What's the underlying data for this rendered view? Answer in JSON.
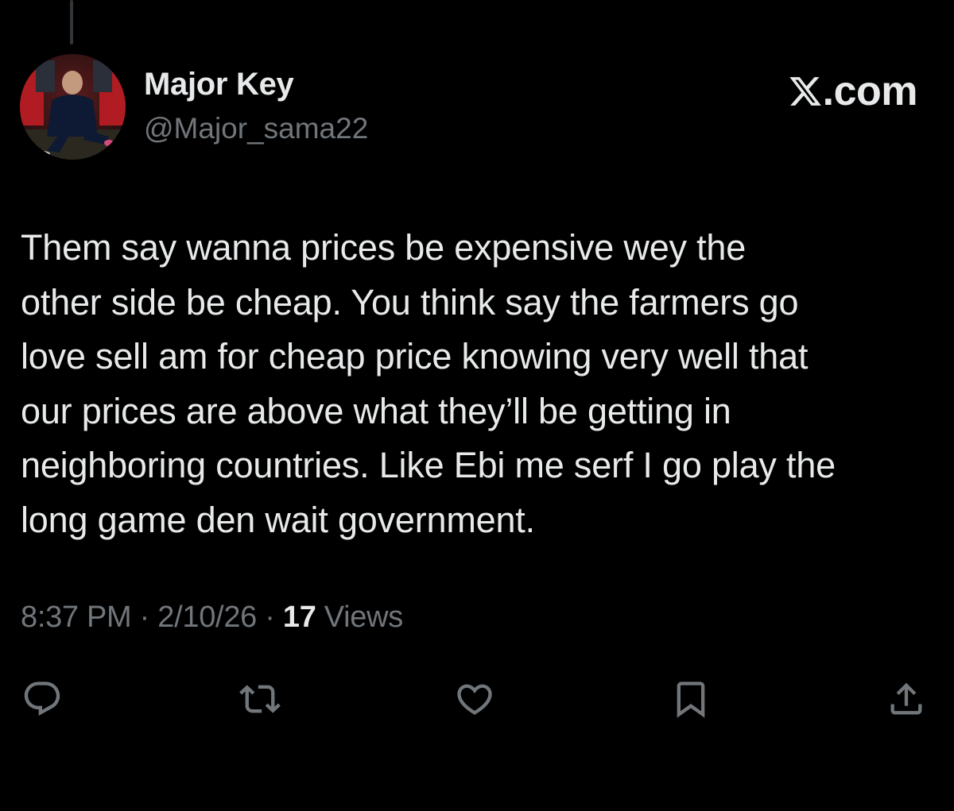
{
  "author": {
    "display_name": "Major Key",
    "handle": "@Major_sama22",
    "avatar_icon": "profile-photo-coach-icon"
  },
  "brand": {
    "label": ".com",
    "icon": "x-logo-icon"
  },
  "tweet": {
    "text": "Them say wanna prices be expensive wey the\nother side be cheap. You think say the farmers go\nlove sell am for cheap price knowing very well that\nour prices are above what they’ll be getting in\nneighboring countries. Like Ebi me serf I go play the\nlong game den wait government."
  },
  "meta": {
    "time": "8:37 PM",
    "separator1": " · ",
    "date": "2/10/26",
    "separator2": " · ",
    "views_count": "17",
    "views_label": " Views"
  },
  "actions": [
    {
      "name": "reply-icon"
    },
    {
      "name": "retweet-icon"
    },
    {
      "name": "like-icon"
    },
    {
      "name": "bookmark-icon"
    },
    {
      "name": "share-icon"
    }
  ],
  "colors": {
    "background": "#000000",
    "primary_text": "#e7e9ea",
    "secondary_text": "#71767b"
  }
}
